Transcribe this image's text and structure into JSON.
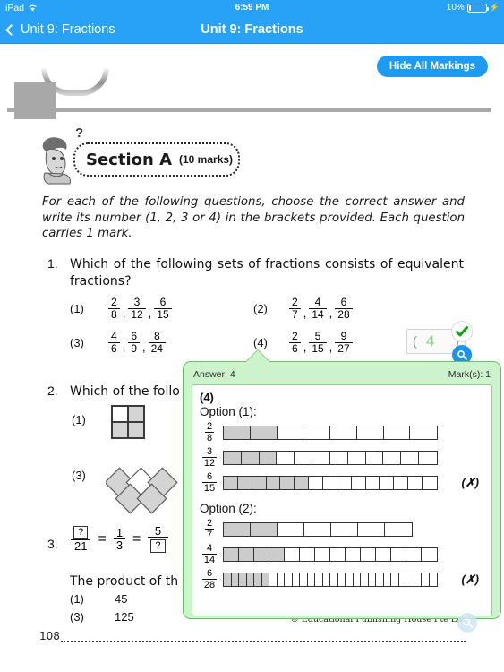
{
  "status_bar": {
    "device": "iPad",
    "wifi_icon": "wifi-icon",
    "time": "6:59 PM",
    "battery_percent": "10%",
    "battery_icon": "battery-icon",
    "charging_icon": "lightning-bolt-icon"
  },
  "nav": {
    "back_label": "Unit 9: Fractions",
    "back_icon": "chevron-left-icon",
    "title": "Unit 9: Fractions"
  },
  "toolbar": {
    "hide_markings_label": "Hide All Markings"
  },
  "section": {
    "question_mark": "?",
    "title": "Section A",
    "marks": "(10 marks)",
    "instructions": "For each of the following questions, choose the correct answer and write its number (1, 2, 3 or 4) in the brackets provided. Each question carries 1 mark."
  },
  "questions": [
    {
      "number": "1.",
      "text": "Which of the following sets of fractions consists of equivalent fractions?",
      "options": [
        {
          "label": "(1)",
          "fractions": [
            [
              "2",
              "8"
            ],
            [
              "3",
              "12"
            ],
            [
              "6",
              "15"
            ]
          ]
        },
        {
          "label": "(2)",
          "fractions": [
            [
              "2",
              "7"
            ],
            [
              "4",
              "14"
            ],
            [
              "6",
              "28"
            ]
          ]
        },
        {
          "label": "(3)",
          "fractions": [
            [
              "4",
              "6"
            ],
            [
              "6",
              "9"
            ],
            [
              "8",
              "24"
            ]
          ]
        },
        {
          "label": "(4)",
          "fractions": [
            [
              "2",
              "6"
            ],
            [
              "5",
              "15"
            ],
            [
              "9",
              "27"
            ]
          ]
        }
      ]
    },
    {
      "number": "2.",
      "text": "Which of the follo",
      "options": [
        {
          "label": "(1)"
        },
        {
          "label": "(3)"
        }
      ]
    },
    {
      "number": "3.",
      "equation": {
        "n1": "?",
        "d1": "21",
        "eq1": "=",
        "n2": "1",
        "d2": "3",
        "eq2": "=",
        "n3": "5",
        "d3": "?"
      },
      "text": "The product of th",
      "options": [
        {
          "label": "(1)",
          "value": "45"
        },
        {
          "label": "(3)",
          "value": "125"
        }
      ]
    }
  ],
  "answer_box": {
    "paren_left": "(",
    "value": "4",
    "paren_right": ")",
    "check_icon": "green-check-icon",
    "key_icon": "key-icon"
  },
  "popup": {
    "answer_label": "Answer: 4",
    "marks_label": "Mark(s): 1",
    "answer_number": "(4)",
    "blocks": [
      {
        "heading": "Option (1):",
        "bars": [
          {
            "num": "2",
            "den": "8",
            "total": 8,
            "shaded": 2
          },
          {
            "num": "3",
            "den": "12",
            "total": 12,
            "shaded": 3
          },
          {
            "num": "6",
            "den": "15",
            "total": 15,
            "shaded": 6
          }
        ],
        "verdict": "(✗)"
      },
      {
        "heading": "Option (2):",
        "bars": [
          {
            "num": "2",
            "den": "7",
            "total": 7,
            "shaded": 2
          },
          {
            "num": "4",
            "den": "14",
            "total": 14,
            "shaded": 4
          },
          {
            "num": "6",
            "den": "28",
            "total": 28,
            "shaded": 6
          }
        ],
        "verdict": "(✗)"
      }
    ]
  },
  "footer": {
    "page_number": "108",
    "credit": "© Educational Publishing House Pte Ltd",
    "key_icon": "key-icon"
  },
  "colors": {
    "brand_blue": "#27a2f7",
    "button_blue": "#1e9bf0",
    "popup_green_bg": "#ccf3cc",
    "popup_green_border": "#63c363",
    "check_green": "#14a014"
  }
}
